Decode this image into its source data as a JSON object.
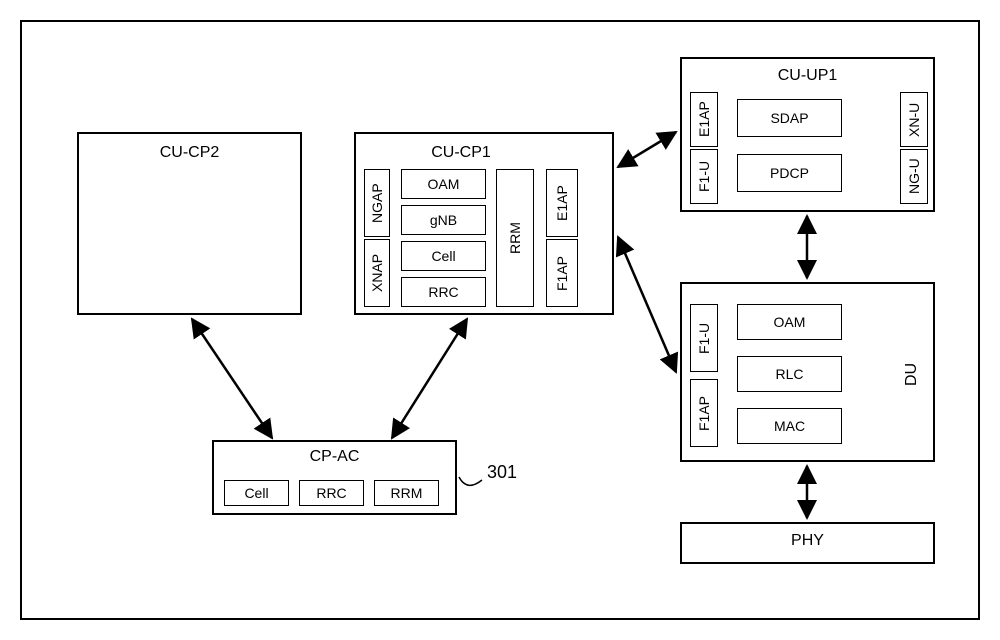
{
  "blocks": {
    "cu_cp2": {
      "title": "CU-CP2"
    },
    "cu_cp1": {
      "title": "CU-CP1",
      "left_col": [
        "XNAP",
        "NGAP"
      ],
      "mid_col": [
        "OAM",
        "gNB",
        "Cell",
        "RRC"
      ],
      "rrm": "RRM",
      "right_col": [
        "E1AP",
        "F1AP"
      ]
    },
    "cu_up1": {
      "title": "CU-UP1",
      "left_col": [
        "F1-U",
        "E1AP"
      ],
      "mid_col": [
        "SDAP",
        "PDCP"
      ],
      "right_col": [
        "NG-U",
        "XN-U"
      ]
    },
    "du": {
      "title": "DU",
      "left_col": [
        "F1AP",
        "F1-U"
      ],
      "mid_col": [
        "OAM",
        "RLC",
        "MAC"
      ]
    },
    "phy": {
      "title": "PHY"
    },
    "cp_ac": {
      "title": "CP-AC",
      "items": [
        "Cell",
        "RRC",
        "RRM"
      ]
    }
  },
  "annotation": "301"
}
